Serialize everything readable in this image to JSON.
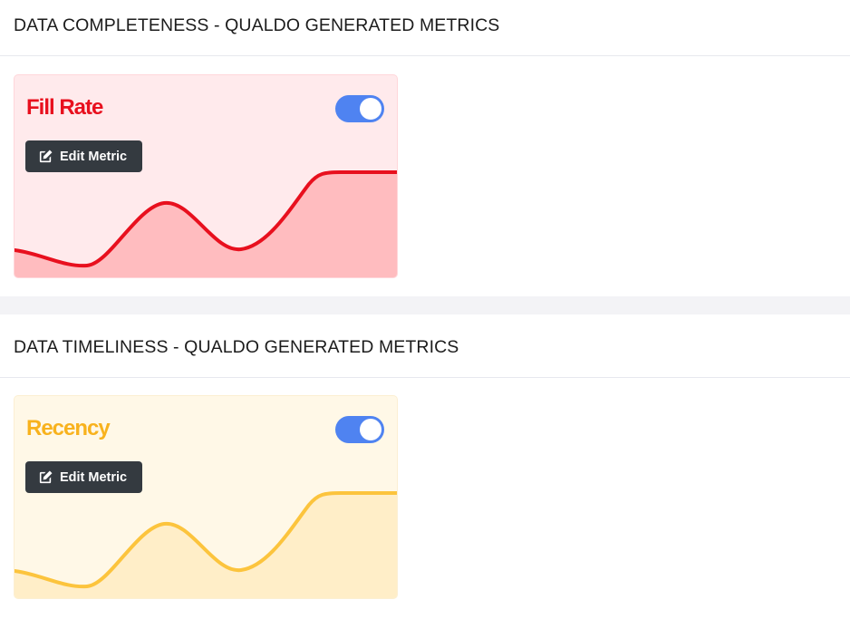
{
  "sections": [
    {
      "title": "DATA COMPLETENESS - QUALDO GENERATED METRICS",
      "card": {
        "title": "Fill Rate",
        "title_color": "#e8101e",
        "line_color": "#e8101e",
        "fill_color": "#ffbcbf",
        "edit_label": "Edit Metric",
        "toggle_on": true
      }
    },
    {
      "title": "DATA TIMELINESS - QUALDO GENERATED METRICS",
      "card": {
        "title": "Recency",
        "title_color": "#f8b21d",
        "line_color": "#fcc43d",
        "fill_color": "#ffeec8",
        "edit_label": "Edit Metric",
        "toggle_on": true
      }
    }
  ],
  "colors": {
    "toggle_accent": "#4f83f1",
    "button_bg": "#343a40"
  },
  "icons": {
    "edit": "edit-icon"
  }
}
